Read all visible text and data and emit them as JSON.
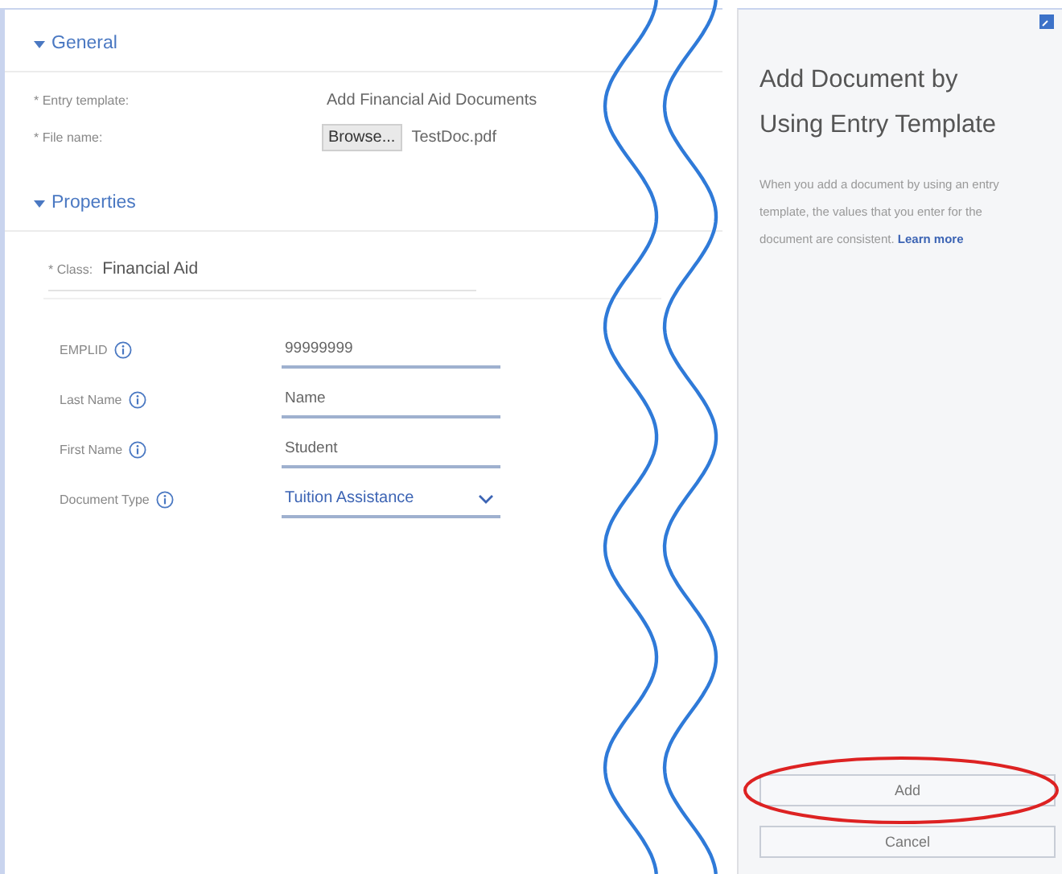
{
  "general": {
    "title": "General",
    "expanded": true,
    "fields": [
      {
        "kind": "text",
        "label": "* Entry template:",
        "value": "Add Financial Aid Documents"
      },
      {
        "kind": "file",
        "label": "* File name:",
        "button": "Browse...",
        "value": "TestDoc.pdf"
      }
    ]
  },
  "properties": {
    "title": "Properties",
    "expanded": true,
    "class": {
      "label": "* Class:",
      "value": "Financial Aid"
    },
    "fields": [
      {
        "kind": "text",
        "label": "EMPLID",
        "value": "99999999"
      },
      {
        "kind": "text",
        "label": "Last Name",
        "value": "Name"
      },
      {
        "kind": "text",
        "label": "First Name",
        "value": "Student"
      },
      {
        "kind": "select",
        "label": "Document Type",
        "value": "Tuition Assistance"
      }
    ]
  },
  "side_panel": {
    "title": "Add Document by Using Entry Template",
    "description": "When you add a document by using an entry template, the values that you enter for the document are consistent.",
    "link": "Learn more",
    "buttons": [
      {
        "label": "Add",
        "highlighted": true
      },
      {
        "label": "Cancel",
        "highlighted": false
      }
    ]
  }
}
